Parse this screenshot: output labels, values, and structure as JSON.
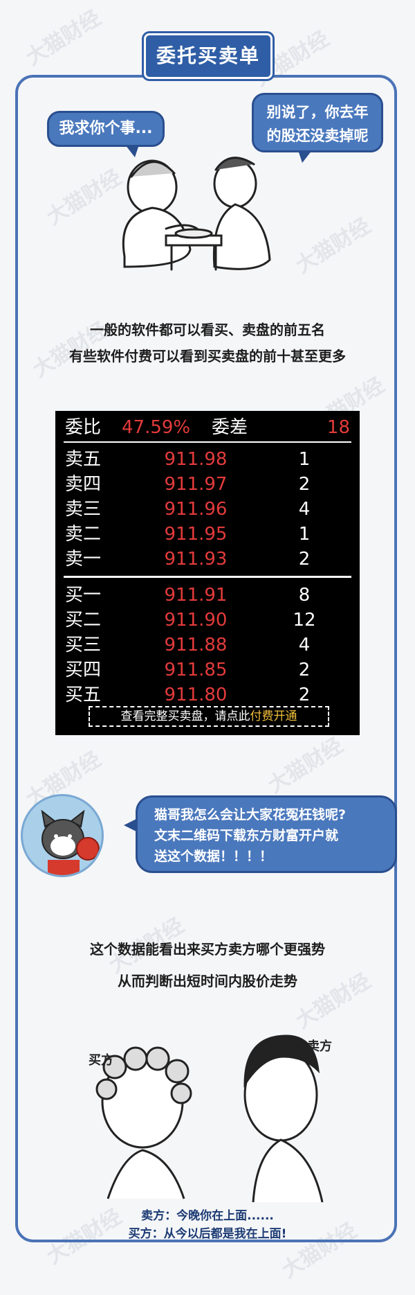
{
  "title": "委托买卖单",
  "bubbles": {
    "left": "我求你个事...",
    "right_line1": "别说了，你去年",
    "right_line2": "的股还没卖掉呢",
    "cat_line1": "猫哥我怎么会让大家花冤枉钱呢?",
    "cat_line2": "文末二维码下载东方财富开户就",
    "cat_line3": "送这个数据！！！！"
  },
  "intro": {
    "line1": "一般的软件都可以看买、卖盘的前五名",
    "line2": "有些软件付费可以看到买卖盘的前十甚至更多"
  },
  "order_book": {
    "ratio_label": "委比",
    "ratio_value": "47.59%",
    "diff_label": "委差",
    "diff_value": "18",
    "asks": [
      {
        "label": "卖五",
        "price": "911.98",
        "volume": "1"
      },
      {
        "label": "卖四",
        "price": "911.97",
        "volume": "2"
      },
      {
        "label": "卖三",
        "price": "911.96",
        "volume": "4"
      },
      {
        "label": "卖二",
        "price": "911.95",
        "volume": "1"
      },
      {
        "label": "卖一",
        "price": "911.93",
        "volume": "2"
      }
    ],
    "bids": [
      {
        "label": "买一",
        "price": "911.91",
        "volume": "8"
      },
      {
        "label": "买二",
        "price": "911.90",
        "volume": "12"
      },
      {
        "label": "买三",
        "price": "911.88",
        "volume": "4"
      },
      {
        "label": "买四",
        "price": "911.85",
        "volume": "2"
      },
      {
        "label": "买五",
        "price": "911.80",
        "volume": "2"
      }
    ],
    "pay_text": "查看完整买卖盘，请点此",
    "pay_link": "付费开通",
    "colors": {
      "price": "#e33b3b",
      "link": "#f2c13a"
    }
  },
  "explain": {
    "line1": "这个数据能看出来买方卖方哪个更强势",
    "line2": "从而判断出短时间内股价走势"
  },
  "comic": {
    "buyer_label": "买方",
    "seller_label": "卖方",
    "sub_line1": "卖方：今晚你在上面......",
    "sub_line2": "买方：从今以后都是我在上面!"
  },
  "watermark": "大猫财经"
}
